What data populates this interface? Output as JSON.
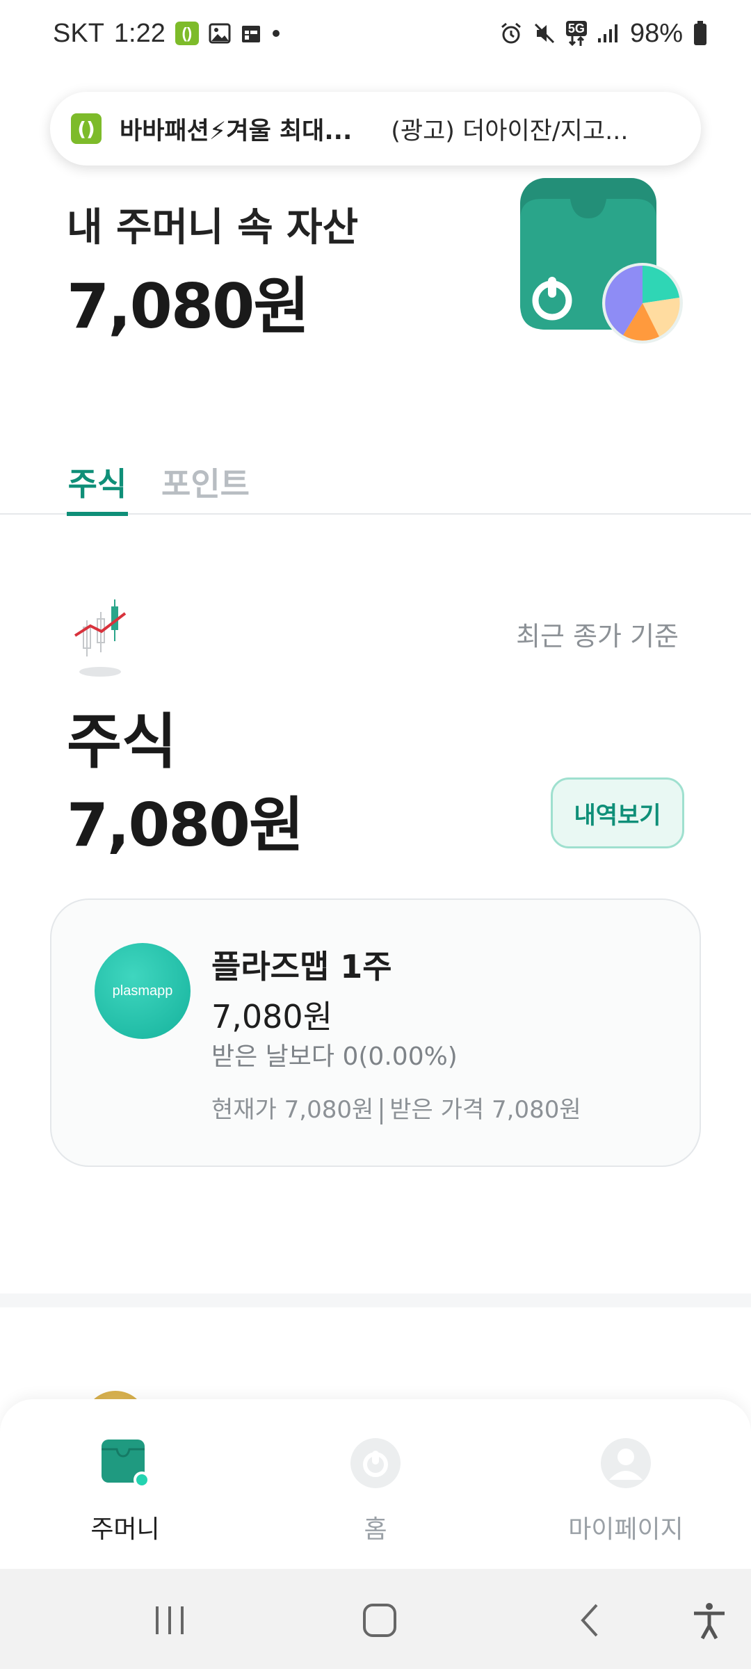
{
  "status_bar": {
    "carrier": "SKT",
    "time": "1:22",
    "network": "5G",
    "battery": "98%"
  },
  "ad": {
    "text_1": "바바패션⚡겨울 최대...",
    "text_2": "(광고) 더아이잔/지고..."
  },
  "header": {
    "title": "내 주머니 속 자산",
    "amount": "7,080원"
  },
  "tabs": [
    {
      "label": "주식",
      "active": true
    },
    {
      "label": "포인트",
      "active": false
    }
  ],
  "stock_section": {
    "basis": "최근 종가 기준",
    "label": "주식",
    "amount": "7,080원",
    "history_button": "내역보기"
  },
  "holding": {
    "logo_text": "plasmapp",
    "name": "플라즈맵 1주",
    "price": "7,080원",
    "change": "받은 날보다 0(0.00%)",
    "current_price": "현재가 7,080원",
    "received_price": "받은 가격 7,080원"
  },
  "bottom_nav": {
    "items": [
      {
        "label": "주머니",
        "icon": "wallet-icon",
        "active": true
      },
      {
        "label": "홈",
        "icon": "home-power-icon",
        "active": false
      },
      {
        "label": "마이페이지",
        "icon": "profile-icon",
        "active": false
      }
    ]
  },
  "colors": {
    "accent": "#0f8f78",
    "accent_light": "#e9f8f3",
    "wallet_green": "#2aa58a",
    "muted": "#8c9196"
  }
}
